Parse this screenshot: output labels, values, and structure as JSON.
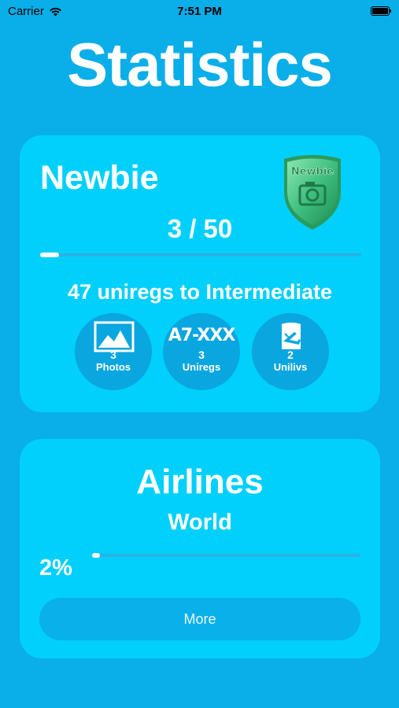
{
  "status_bar": {
    "carrier": "Carrier",
    "time": "7:51 PM"
  },
  "title": "Statistics",
  "level_card": {
    "level_name": "Newbie",
    "badge_text": "Newbie",
    "progress_text": "3 / 50",
    "progress_fraction": 0.06,
    "next_level_text": "47 uniregs to Intermediate",
    "stats": [
      {
        "icon": "photo-icon",
        "value": "3",
        "label": "Photos"
      },
      {
        "icon_text": "A7-XXX",
        "value": "3",
        "label": "Uniregs"
      },
      {
        "icon": "livery-icon",
        "value": "2",
        "label": "Unilivs"
      }
    ]
  },
  "airlines_card": {
    "title": "Airlines",
    "region": "World",
    "percent_text": "2%",
    "progress_fraction": 0.02,
    "more_label": "More"
  },
  "colors": {
    "background": "#0aaee8",
    "card": "#00d0fb",
    "circle": "#0aa6e0",
    "badge_green": "#3fbf7f"
  }
}
